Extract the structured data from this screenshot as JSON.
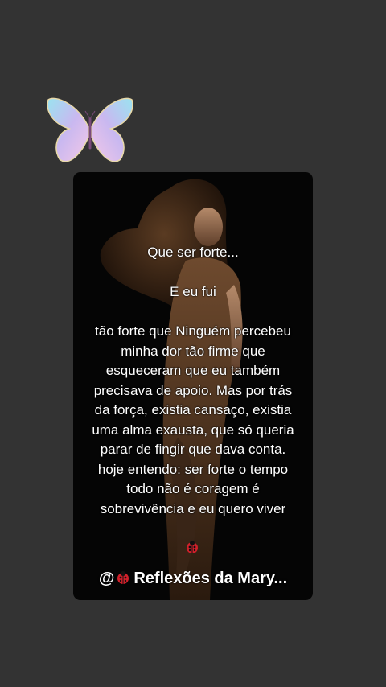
{
  "story": {
    "line1": "Que ser forte...",
    "line2": "E eu fui",
    "paragraph": "tão forte que Ninguém percebeu minha dor tão firme que esqueceram que eu também precisava de apoio. Mas por trás da força, existia cansaço, existia uma alma exausta, que só queria parar de fingir que dava conta. hoje entendo: ser forte o tempo todo não é coragem é sobrevivência e eu quero viver",
    "credit_prefix": "@",
    "credit_name": "Reflexões da Mary...",
    "sticker_icon": "butterfly-icon",
    "emoji_icon": "ladybug-icon"
  },
  "colors": {
    "background": "#333333",
    "card": "#050505",
    "text": "#ffffff",
    "ladybug": "#d0202a"
  }
}
